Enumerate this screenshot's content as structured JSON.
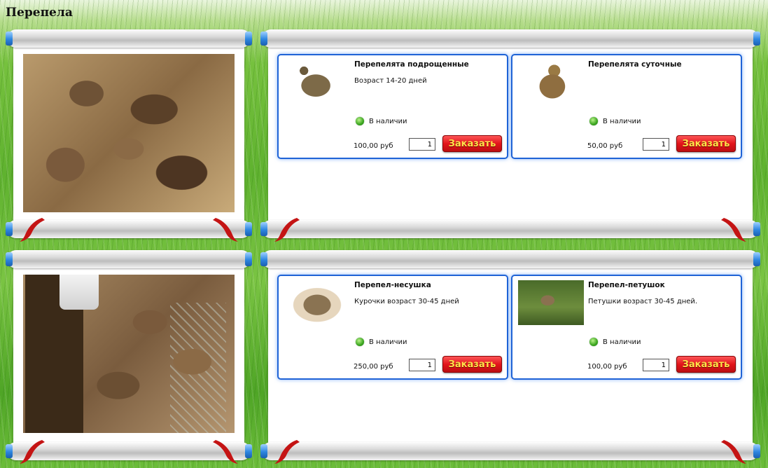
{
  "page": {
    "title": "Перепела"
  },
  "rows": [
    {
      "products": [
        {
          "name": "Перепелята подрощенные",
          "description": "Возраст 14-20 дней",
          "availability": "В наличии",
          "price": "100,00 руб",
          "quantity": "1",
          "order_label": "Заказать",
          "image_icon": "quail-bird-icon"
        },
        {
          "name": "Перепелята суточные",
          "description": "",
          "availability": "В наличии",
          "price": "50,00 руб",
          "quantity": "1",
          "order_label": "Заказать",
          "image_icon": "chick-icon"
        }
      ]
    },
    {
      "products": [
        {
          "name": "Перепел-несушка",
          "description": "Курочки возраст 30-45 дней",
          "availability": "В наличии",
          "price": "250,00 руб",
          "quantity": "1",
          "order_label": "Заказать",
          "image_icon": "quail-bird-icon"
        },
        {
          "name": "Перепел-петушок",
          "description": "Петушки возраст 30-45 дней.",
          "availability": "В наличии",
          "price": "100,00 руб",
          "quantity": "1",
          "order_label": "Заказать",
          "image_icon": "quail-bird-icon"
        }
      ]
    }
  ],
  "colors": {
    "card_border": "#1f63d6",
    "order_button": "#e2151b",
    "order_text": "#ffe24a",
    "stock_indicator": "#3aa51e"
  }
}
